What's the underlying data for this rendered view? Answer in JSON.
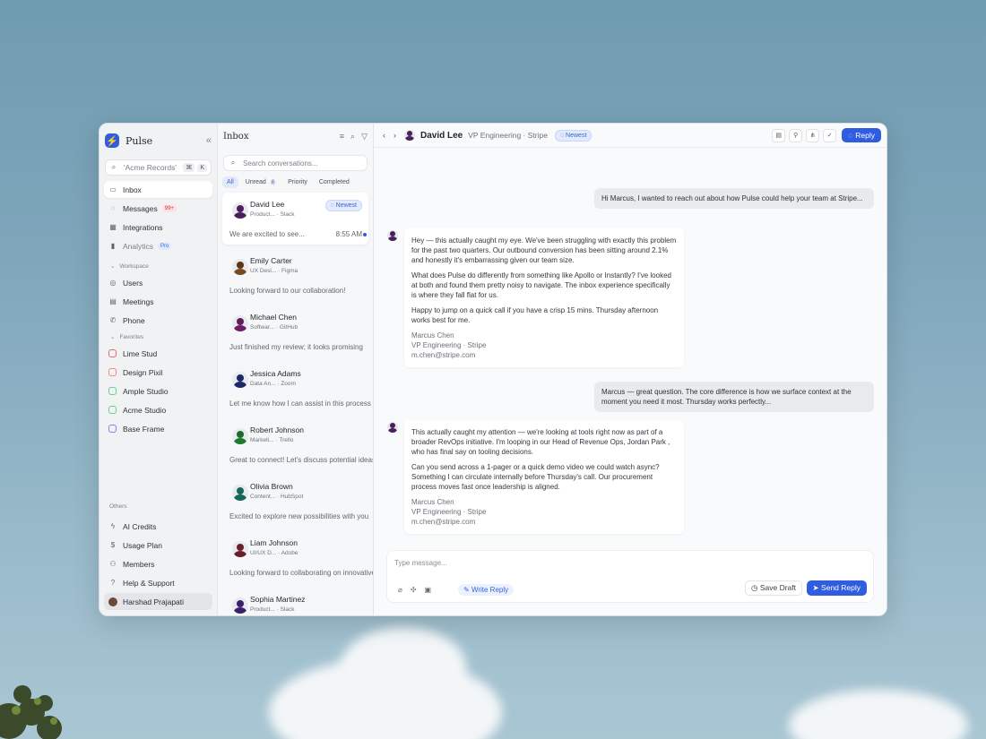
{
  "app": {
    "name": "Pulse",
    "collapse_icon": "double-chevron-left-icon"
  },
  "sidebar": {
    "search_placeholder": "'Acme Records'",
    "search_kbd": [
      "⌘",
      "K"
    ],
    "nav": [
      {
        "label": "Inbox",
        "icon": "inbox-icon",
        "active": true
      },
      {
        "label": "Messages",
        "icon": "message-icon",
        "badge": "99+"
      },
      {
        "label": "Integrations",
        "icon": "grid-icon"
      },
      {
        "label": "Analytics",
        "icon": "bar-chart-icon",
        "badge": "Pro"
      }
    ],
    "workspace_label": "Workspace",
    "workspace": [
      {
        "label": "Users",
        "icon": "user-circle-icon"
      },
      {
        "label": "Meetings",
        "icon": "calendar-icon"
      },
      {
        "label": "Phone",
        "icon": "phone-icon"
      }
    ],
    "favorites_label": "Favorites",
    "favorites": [
      {
        "label": "Lime Stud",
        "color": "#e86a72"
      },
      {
        "label": "Design Pixil",
        "color": "#ef8c7a"
      },
      {
        "label": "Ample Studio",
        "color": "#6ccf8f"
      },
      {
        "label": "Acme Studio",
        "color": "#6ccf8f"
      },
      {
        "label": "Base Frame",
        "color": "#8c7ff0"
      }
    ],
    "others_label": "Others",
    "others": [
      {
        "label": "AI Credits",
        "icon": "bolt-icon"
      },
      {
        "label": "Usage Plan",
        "icon": "dollar-icon"
      },
      {
        "label": "Members",
        "icon": "users-icon"
      },
      {
        "label": "Help & Support",
        "icon": "help-icon"
      }
    ],
    "user": "Harshad Prajapati"
  },
  "inbox": {
    "title": "Inbox",
    "search_placeholder": "Search conversations...",
    "filters": [
      {
        "label": "All",
        "active": true
      },
      {
        "label": "Unread",
        "count": "8"
      },
      {
        "label": "Priority"
      },
      {
        "label": "Completed"
      }
    ],
    "conversations": [
      {
        "name": "David Lee",
        "role": "Product...",
        "app": "Slack",
        "preview": "We are excited to see...",
        "time": "8:55 AM",
        "badge": "Newest",
        "unread": true,
        "head": "#4a1f5c",
        "body": "#4a1f5c",
        "selected": true
      },
      {
        "name": "Emily Carter",
        "role": "UX Desi...",
        "app": "Figma",
        "preview": "Looking forward to our collaboration!",
        "head": "#5a3516",
        "body": "#7a4a1f"
      },
      {
        "name": "Michael Chen",
        "role": "Softwar...",
        "app": "GitHub",
        "preview": "Just finished my review; it looks promising",
        "head": "#5c1f5a",
        "body": "#6b1e66"
      },
      {
        "name": "Jessica Adams",
        "role": "Data An...",
        "app": "Zoom",
        "preview": "Let me know how I can assist in this process",
        "head": "#1b2a66",
        "body": "#1b2a66"
      },
      {
        "name": "Robert Johnson",
        "role": "Marketi...",
        "app": "Trello",
        "preview": "Great to connect! Let's discuss potential ideas",
        "head": "#1d6b2a",
        "body": "#1d7a2e"
      },
      {
        "name": "Olivia Brown",
        "role": "Content...",
        "app": "HubSpot",
        "preview": "Excited to explore new possibilities with you",
        "head": "#16665a",
        "body": "#16665a"
      },
      {
        "name": "Liam Johnson",
        "role": "UI/UX D...",
        "app": "Adobe",
        "preview": "Looking forward to collaborating on innovative",
        "head": "#6b1e2a",
        "body": "#6b1e2a"
      },
      {
        "name": "Sophia Martinez",
        "role": "Product...",
        "app": "Slack",
        "preview": "",
        "head": "#3a1f6b",
        "body": "#3a1f6b"
      }
    ]
  },
  "thread": {
    "contact": "David Lee",
    "contact_title": "VP Engineering · Stripe",
    "badge": "Newest",
    "reply_label": "Reply",
    "header_icons": [
      "calendar-icon",
      "user-icon",
      "share-icon",
      "check-circle-icon"
    ],
    "messages": [
      {
        "dir": "out",
        "text": "Hi Marcus, I wanted to reach out about how Pulse could help your team at Stripe..."
      },
      {
        "dir": "in",
        "paragraphs": [
          "Hey — this actually caught my eye. We've been struggling with exactly this problem for the past two quarters. Our outbound conversion has been sitting around 2.1% and honestly it's embarrassing given our team size.",
          "What does Pulse do differently from something like Apollo or Instantly? I've looked at both and found them pretty noisy to navigate. The inbox experience specifically is where they fall flat for us.",
          "Happy to jump on a quick call if you have a crisp 15 mins. Thursday afternoon works best for me."
        ],
        "sig": [
          "Marcus Chen",
          "VP Engineering · Stripe",
          "m.chen@stripe.com"
        ]
      },
      {
        "dir": "out",
        "text": "Marcus — great question. The core difference is how we surface context at the moment you need it most. Thursday works perfectly..."
      },
      {
        "dir": "in",
        "paragraphs": [
          "This actually caught my attention — we're looking at tools right now as part of a broader RevOps initiative. I'm looping in our Head of Revenue Ops, Jordan Park , who has final say on tooling decisions.",
          "Can you send across a 1-pager or a quick demo video we could watch async? Something I can circulate internally before Thursday's call. Our procurement process moves fast once leadership is aligned."
        ],
        "sig": [
          "Marcus Chen",
          "VP Engineering · Stripe",
          "m.chen@stripe.com"
        ]
      }
    ]
  },
  "composer": {
    "placeholder": "Type message...",
    "write_reply": "Write Reply",
    "save_draft": "Save Draft",
    "send_reply": "Send Reply"
  },
  "colors": {
    "accent": "#2f5de0"
  }
}
